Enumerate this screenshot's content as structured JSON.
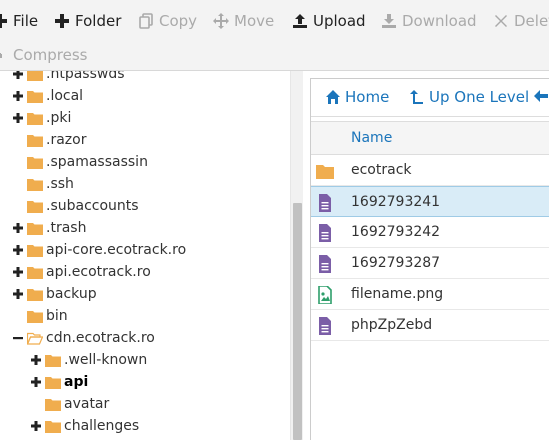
{
  "toolbar": {
    "row1": [
      {
        "label": "File",
        "icon": "plus-icon",
        "enabled": true
      },
      {
        "label": "Folder",
        "icon": "plus-icon",
        "enabled": true
      },
      {
        "label": "Copy",
        "icon": "copy-icon",
        "enabled": false
      },
      {
        "label": "Move",
        "icon": "move-icon",
        "enabled": false
      },
      {
        "label": "Upload",
        "icon": "upload-icon",
        "enabled": true
      },
      {
        "label": "Download",
        "icon": "download-icon",
        "enabled": false
      },
      {
        "label": "Delete",
        "icon": "delete-icon",
        "enabled": false
      }
    ],
    "row2": [
      {
        "label": "Compress",
        "icon": "compress-icon",
        "enabled": false
      }
    ]
  },
  "tree": {
    "items": [
      {
        "label": ".htpasswds",
        "depth": 0,
        "toggle": "plus"
      },
      {
        "label": ".local",
        "depth": 0,
        "toggle": "plus"
      },
      {
        "label": ".pki",
        "depth": 0,
        "toggle": "plus"
      },
      {
        "label": ".razor",
        "depth": 0,
        "toggle": "none"
      },
      {
        "label": ".spamassassin",
        "depth": 0,
        "toggle": "none"
      },
      {
        "label": ".ssh",
        "depth": 0,
        "toggle": "none"
      },
      {
        "label": ".subaccounts",
        "depth": 0,
        "toggle": "none"
      },
      {
        "label": ".trash",
        "depth": 0,
        "toggle": "plus"
      },
      {
        "label": "api-core.ecotrack.ro",
        "depth": 0,
        "toggle": "plus"
      },
      {
        "label": "api.ecotrack.ro",
        "depth": 0,
        "toggle": "plus"
      },
      {
        "label": "backup",
        "depth": 0,
        "toggle": "plus"
      },
      {
        "label": "bin",
        "depth": 0,
        "toggle": "none"
      },
      {
        "label": "cdn.ecotrack.ro",
        "depth": 0,
        "toggle": "minus",
        "open": true
      },
      {
        "label": ".well-known",
        "depth": 1,
        "toggle": "plus"
      },
      {
        "label": "api",
        "depth": 1,
        "toggle": "plus",
        "bold": true
      },
      {
        "label": "avatar",
        "depth": 1,
        "toggle": "none"
      },
      {
        "label": "challenges",
        "depth": 1,
        "toggle": "plus"
      }
    ]
  },
  "nav": {
    "home": "Home",
    "up": "Up One Level"
  },
  "list": {
    "column_name": "Name",
    "rows": [
      {
        "name": "ecotrack",
        "type": "folder"
      },
      {
        "name": "1692793241",
        "type": "file",
        "selected": true
      },
      {
        "name": "1692793242",
        "type": "file"
      },
      {
        "name": "1692793287",
        "type": "file"
      },
      {
        "name": "filename.png",
        "type": "image"
      },
      {
        "name": "phpZpZebd",
        "type": "file"
      }
    ]
  },
  "colors": {
    "accent": "#1b75bb",
    "folder": "#f0ad4e",
    "file": "#7b5ea7",
    "image": "#2e9e6b",
    "selected": "#d9ecf7"
  }
}
